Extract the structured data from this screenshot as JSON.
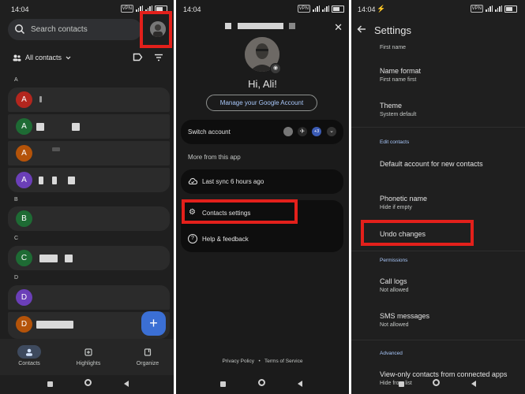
{
  "status": {
    "time_1": "14:04",
    "time_2": "14:04",
    "time_3": "14:04"
  },
  "panel1": {
    "search_placeholder": "Search contacts",
    "filter_label": "All contacts",
    "sections": {
      "a": "A",
      "b": "B",
      "c": "C",
      "d": "D"
    },
    "contacts": {
      "c1": "A",
      "c2": "A",
      "c3": "A",
      "c4": "A",
      "c5": "B",
      "c6": "C",
      "c7": "D",
      "c8": "D"
    },
    "fab": "+",
    "nav": {
      "contacts": "Contacts",
      "highlights": "Highlights",
      "organize": "Organize"
    }
  },
  "panel2": {
    "greeting": "Hi, Ali!",
    "manage_account": "Manage your Google Account",
    "switch_account": "Switch account",
    "more_badge": "+3",
    "more_from_app": "More from this app",
    "last_sync": "Last sync 6 hours ago",
    "contacts_settings": "Contacts settings",
    "help_feedback": "Help & feedback",
    "privacy_policy": "Privacy Policy",
    "dot": "•",
    "terms": "Terms of Service"
  },
  "panel3": {
    "title": "Settings",
    "first_name_sub": "First name",
    "name_format": "Name format",
    "name_format_value": "First name first",
    "theme": "Theme",
    "theme_value": "System default",
    "edit_contacts_header": "Edit contacts",
    "default_account": "Default account for new contacts",
    "phonetic_name": "Phonetic name",
    "phonetic_value": "Hide if empty",
    "undo_changes": "Undo changes",
    "permissions_header": "Permissions",
    "call_logs": "Call logs",
    "call_logs_value": "Not allowed",
    "sms_messages": "SMS messages",
    "sms_value": "Not allowed",
    "advanced_header": "Advanced",
    "view_only": "View-only contacts from connected apps",
    "view_only_value": "Hide from list"
  },
  "colors": {
    "highlight": "#e3201b",
    "accent": "#a8c7fa",
    "fab": "#3b6fd4",
    "avatar_red": "#b3261e",
    "avatar_green": "#1e6b34",
    "avatar_orange": "#b45309",
    "avatar_purple": "#6b3fb8"
  }
}
